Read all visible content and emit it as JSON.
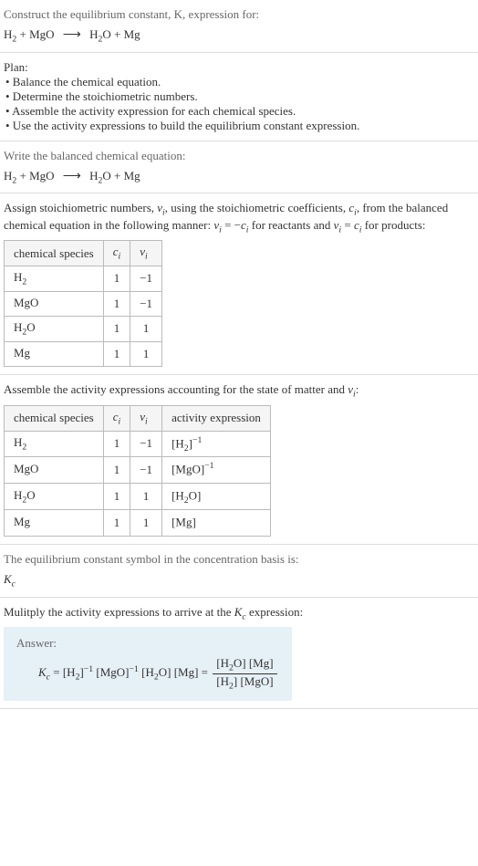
{
  "intro": {
    "prompt": "Construct the equilibrium constant, K, expression for:",
    "eq_lhs1": "H",
    "eq_lhs1_sub": "2",
    "eq_plus1": " + MgO ",
    "eq_rhs1": " H",
    "eq_rhs1_sub": "2",
    "eq_rhs2": "O + Mg"
  },
  "plan": {
    "title": "Plan:",
    "b1": "• Balance the chemical equation.",
    "b2": "• Determine the stoichiometric numbers.",
    "b3": "• Assemble the activity expression for each chemical species.",
    "b4": "• Use the activity expressions to build the equilibrium constant expression."
  },
  "balanced": {
    "prompt": "Write the balanced chemical equation:"
  },
  "stoich": {
    "prompt1": "Assign stoichiometric numbers, ",
    "nu": "ν",
    "sub_i": "i",
    "prompt2": ", using the stoichiometric coefficients, ",
    "c": "c",
    "prompt3": ", from the balanced chemical equation in the following manner: ",
    "eq1": " = −",
    "prompt4": " for reactants and ",
    "eq2": " = ",
    "prompt5": " for products:",
    "headers": {
      "species": "chemical species",
      "ci": "c",
      "nui": "ν"
    },
    "rows": [
      {
        "species": "H",
        "species_sub": "2",
        "species_rest": "",
        "ci": "1",
        "nui": "−1"
      },
      {
        "species": "MgO",
        "species_sub": "",
        "species_rest": "",
        "ci": "1",
        "nui": "−1"
      },
      {
        "species": "H",
        "species_sub": "2",
        "species_rest": "O",
        "ci": "1",
        "nui": "1"
      },
      {
        "species": "Mg",
        "species_sub": "",
        "species_rest": "",
        "ci": "1",
        "nui": "1"
      }
    ]
  },
  "activity": {
    "prompt": "Assemble the activity expressions accounting for the state of matter and ",
    "prompt2": ":",
    "headers": {
      "species": "chemical species",
      "ci": "c",
      "nui": "ν",
      "expr": "activity expression"
    },
    "rows": [
      {
        "species": "H",
        "species_sub": "2",
        "species_rest": "",
        "ci": "1",
        "nui": "−1",
        "expr_base": "[H",
        "expr_sub": "2",
        "expr_mid": "]",
        "expr_sup": "−1"
      },
      {
        "species": "MgO",
        "species_sub": "",
        "species_rest": "",
        "ci": "1",
        "nui": "−1",
        "expr_base": "[MgO]",
        "expr_sub": "",
        "expr_mid": "",
        "expr_sup": "−1"
      },
      {
        "species": "H",
        "species_sub": "2",
        "species_rest": "O",
        "ci": "1",
        "nui": "1",
        "expr_base": "[H",
        "expr_sub": "2",
        "expr_mid": "O]",
        "expr_sup": ""
      },
      {
        "species": "Mg",
        "species_sub": "",
        "species_rest": "",
        "ci": "1",
        "nui": "1",
        "expr_base": "[Mg]",
        "expr_sub": "",
        "expr_mid": "",
        "expr_sup": ""
      }
    ]
  },
  "symbol": {
    "prompt": "The equilibrium constant symbol in the concentration basis is:",
    "k": "K",
    "ksub": "c"
  },
  "multiply": {
    "prompt1": "Mulitply the activity expressions to arrive at the ",
    "prompt2": " expression:"
  },
  "answer": {
    "label": "Answer:",
    "k": "K",
    "ksub": "c",
    "eq": " = [H",
    "h2sub": "2",
    "part2": "]",
    "sup1": "−1",
    "part3": " [MgO]",
    "sup2": "−1",
    "part4": " [H",
    "part5": "O] [Mg] = ",
    "num1": "[H",
    "num2": "O] [Mg]",
    "den1": "[H",
    "den2": "] [MgO]"
  }
}
